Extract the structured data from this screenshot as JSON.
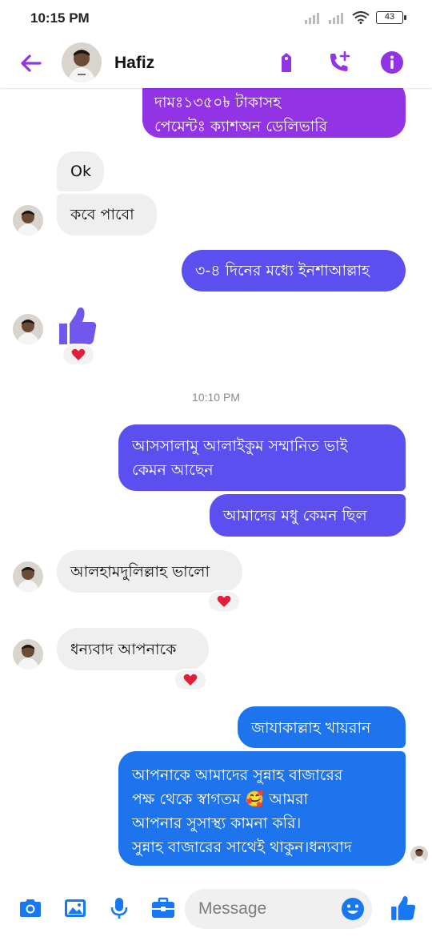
{
  "status": {
    "time": "10:15 PM",
    "battery": "43"
  },
  "header": {
    "name": "Hafiz"
  },
  "messages": {
    "m1_line1": "দামঃ১৩৫০৳ টাকাসহ",
    "m1_line2": "পেমেন্টঃ ক্যাশঅন ডেলিভারি",
    "m2": "Ok",
    "m3": "কবে পাবো",
    "m4": "৩-৪ দিনের মধ্যে ইনশাআল্লাহ",
    "timestamp": "10:10 PM",
    "m5_line1": "আসসালামু আলাইকুম সম্মানিত ভাই",
    "m5_line2": "কেমন আছেন",
    "m6": "আমাদের মধু কেমন ছিল",
    "m7": "আলহামদুলিল্লাহ ভালো",
    "m8": "ধন্যবাদ আপনাকে",
    "m9": "জাযাকাল্লাহ খায়রান",
    "m10_line1": "আপনাকে আমাদের সুন্নাহ বাজারের",
    "m10_line2": "পক্ষ থেকে স্বাগতম 🥰 আমরা",
    "m10_line3": "আপনার সুসাস্থ্য কামনা করি।",
    "m10_line4": "সুন্নাহ বাজারের সাথেই থাকুন।ধন্যবাদ"
  },
  "composer": {
    "placeholder": "Message"
  },
  "colors": {
    "accent": "#9333e6",
    "bubble_purple": "#9333e6",
    "bubble_violet": "#5b4ff0",
    "bubble_blue": "#1d74ec",
    "like_blue": "#1877f2",
    "reaction_red": "#e0203a"
  }
}
